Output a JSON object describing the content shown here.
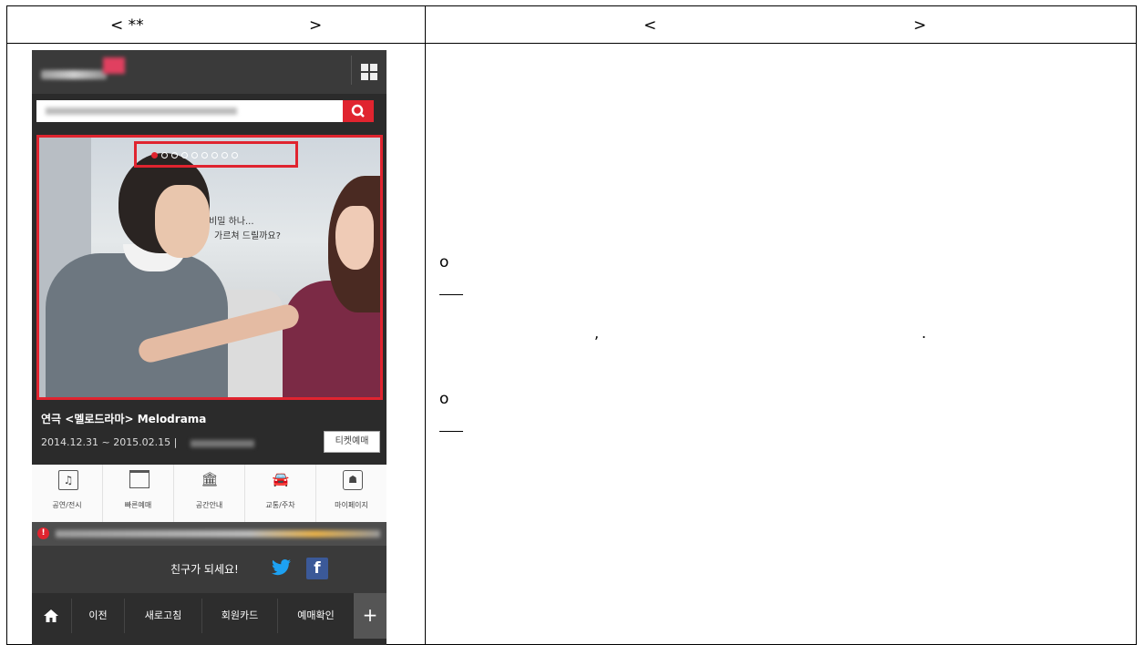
{
  "table": {
    "left_header": {
      "open": "< **",
      "close": ">"
    },
    "right_header": {
      "open": "<",
      "close": ">"
    }
  },
  "phone": {
    "hero": {
      "caption_line1": "비밀 하나...",
      "caption_line2": "가르쳐 드릴까요?",
      "dots_total": 9,
      "dot_active_index": 0
    },
    "show": {
      "title": "연극 <멜로드라마> Melodrama",
      "dates": "2014.12.31 ~ 2015.02.15 |",
      "ticket_button": "티켓예매"
    },
    "menu": [
      {
        "icon": "music-note-icon",
        "label": "공연/전시"
      },
      {
        "icon": "ticket-icon",
        "label": "빠른예매"
      },
      {
        "icon": "building-icon",
        "label": "공간안내"
      },
      {
        "icon": "car-icon",
        "label": "교통/주차"
      },
      {
        "icon": "user-card-icon",
        "label": "마이페이지"
      }
    ],
    "notice_icon": "!",
    "social": {
      "text": "친구가 되세요!",
      "facebook": "f"
    },
    "bottom_nav": {
      "prev": "이전",
      "refresh": "새로고침",
      "member_card": "회원카드",
      "booking_check": "예매확인",
      "plus": "+"
    }
  },
  "right": {
    "bullet1": "o",
    "bullet2": "o",
    "comma": ",",
    "period": "."
  },
  "colors": {
    "accent": "#e0242f",
    "twitter": "#1da1f2",
    "facebook": "#3b5998"
  }
}
